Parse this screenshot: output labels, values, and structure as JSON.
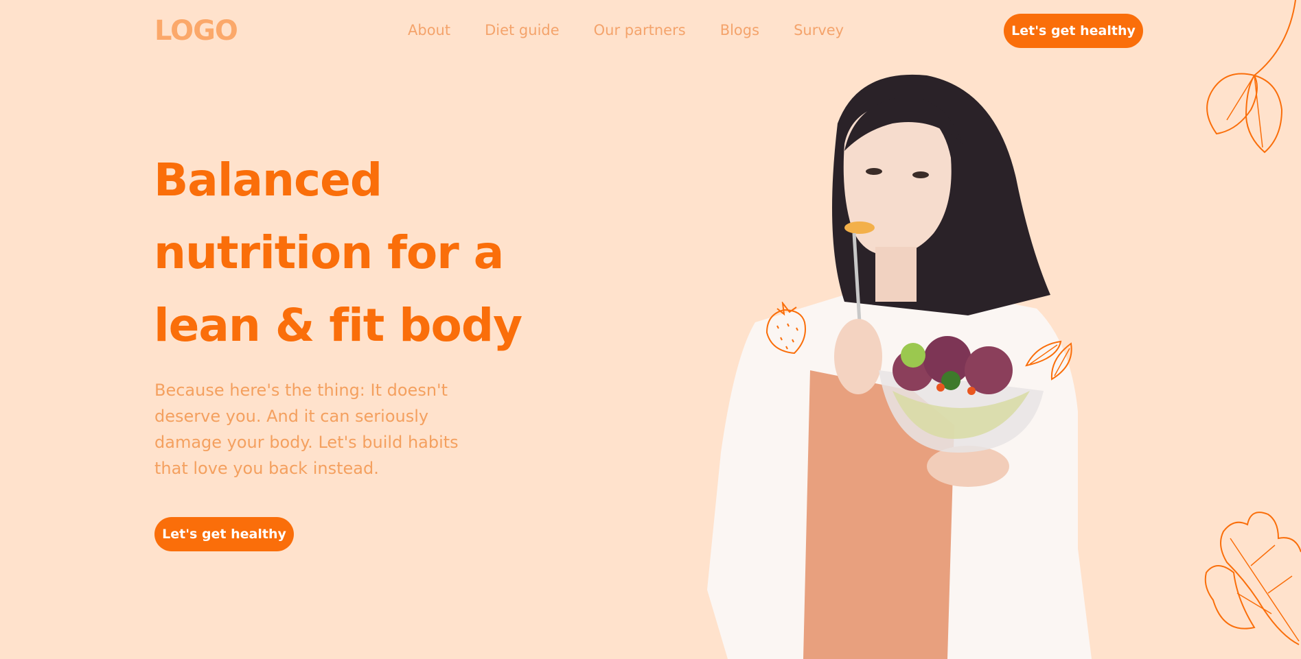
{
  "header": {
    "logo": "LOGO",
    "nav": [
      {
        "label": "About"
      },
      {
        "label": "Diet guide"
      },
      {
        "label": "Our partners"
      },
      {
        "label": "Blogs"
      },
      {
        "label": "Survey"
      }
    ],
    "cta_label": "Let's get healthy"
  },
  "hero": {
    "title_lines": [
      "Balanced",
      "nutrition for a",
      "lean & fit body"
    ],
    "description": "Because here's the thing: It doesn't deserve you. And it can seriously damage your body. Let's build habits that love you back instead.",
    "cta_label": "Let's get healthy"
  },
  "colors": {
    "background": "#ffe2cc",
    "accent": "#fa6e0a",
    "muted": "#f4a36b"
  },
  "icons": [
    "spinach-leaf-icon",
    "strawberry-icon",
    "almond-icon",
    "oak-leaf-icon"
  ]
}
